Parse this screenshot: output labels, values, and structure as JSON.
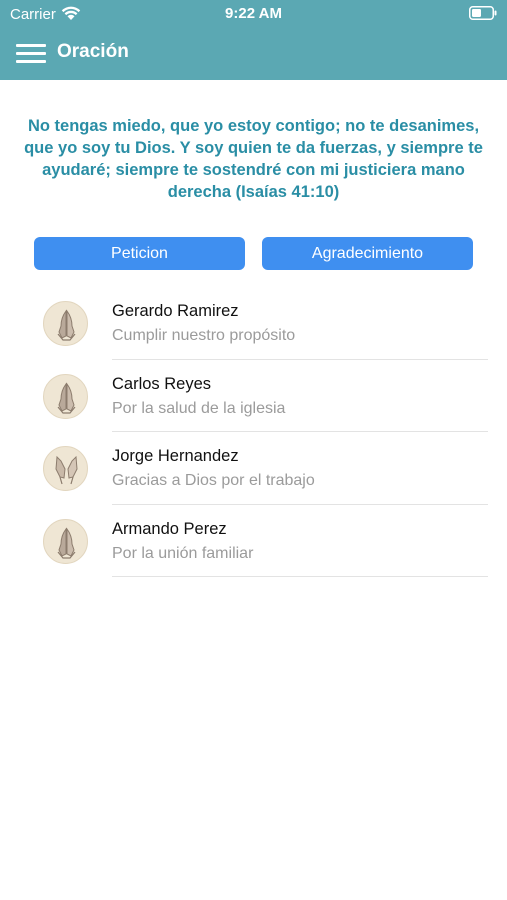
{
  "status_bar": {
    "carrier": "Carrier",
    "time": "9:22 AM"
  },
  "nav": {
    "title": "Oración"
  },
  "verse": "No tengas miedo, que yo estoy contigo; no te desanimes, que yo soy tu Dios. Y soy quien te da fuerzas, y siempre te ayudaré; siempre te sostendré con mi justiciera mano derecha (Isaías 41:10)",
  "buttons": {
    "peticion": "Peticion",
    "agradecimiento": "Agradecimiento"
  },
  "list": [
    {
      "name": "Gerardo Ramirez",
      "subtitle": "Cumplir nuestro propósito",
      "icon": "praying-hands-icon"
    },
    {
      "name": "Carlos Reyes",
      "subtitle": "Por la salud de la iglesia",
      "icon": "praying-hands-icon"
    },
    {
      "name": "Jorge Hernandez",
      "subtitle": "Gracias a Dios por el trabajo",
      "icon": "raised-hands-icon"
    },
    {
      "name": "Armando Perez",
      "subtitle": "Por la unión familiar",
      "icon": "praying-hands-icon"
    }
  ],
  "colors": {
    "header": "#5ba8b3",
    "verse": "#2a8ea5",
    "button": "#3f8ff0"
  }
}
